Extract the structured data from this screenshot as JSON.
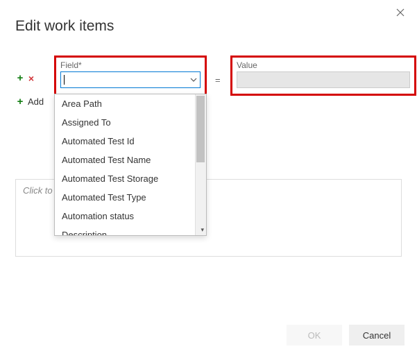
{
  "dialog": {
    "title": "Edit work items",
    "field_label": "Field*",
    "value_label": "Value",
    "equals": "=",
    "add_new_label": "Add",
    "notes_placeholder": "Click to",
    "ok_label": "OK",
    "cancel_label": "Cancel"
  },
  "field_combo": {
    "value": ""
  },
  "value_box": {
    "value": ""
  },
  "dropdown": {
    "items": [
      "Area Path",
      "Assigned To",
      "Automated Test Id",
      "Automated Test Name",
      "Automated Test Storage",
      "Automated Test Type",
      "Automation status",
      "Description"
    ]
  }
}
